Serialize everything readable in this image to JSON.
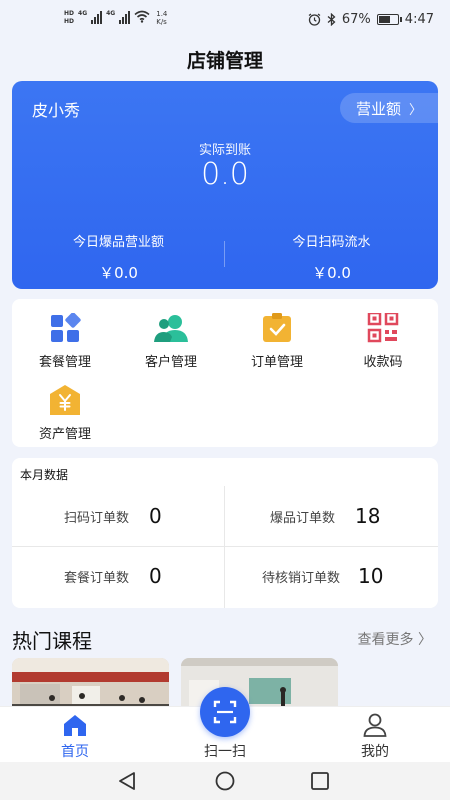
{
  "status_bar": {
    "hd_top": "HD",
    "hd_bottom": "HD",
    "net1": "4G",
    "net2": "4G",
    "speed_value": "1.4",
    "speed_unit": "K/s",
    "battery_percent": "67%",
    "battery_level": 0.67,
    "time": "4:47"
  },
  "page_title": "店铺管理",
  "hero": {
    "name": "皮小秀",
    "revenue_button": "营业额",
    "received_label": "实际到账",
    "received_amount": "0.0",
    "left_label": "今日爆品营业额",
    "left_value": "￥0.0",
    "right_label": "今日扫码流水",
    "right_value": "￥0.0",
    "color": "#2f66ef"
  },
  "menu": {
    "items": [
      {
        "label": "套餐管理",
        "icon": "package-grid-icon",
        "color": "#3f6fe8"
      },
      {
        "label": "客户管理",
        "icon": "customer-icon",
        "color": "#2bbf9a"
      },
      {
        "label": "订单管理",
        "icon": "order-clipboard-icon",
        "color": "#f2b333"
      },
      {
        "label": "收款码",
        "icon": "qr-code-icon",
        "color": "#e0485c"
      },
      {
        "label": "资产管理",
        "icon": "asset-yen-icon",
        "color": "#f2b333"
      }
    ]
  },
  "month": {
    "title": "本月数据",
    "stats": [
      {
        "label": "扫码订单数",
        "value": "0"
      },
      {
        "label": "爆品订单数",
        "value": "18"
      },
      {
        "label": "套餐订单数",
        "value": "0"
      },
      {
        "label": "待核销订单数",
        "value": "10"
      }
    ]
  },
  "courses": {
    "title": "热门课程",
    "see_more": "查看更多"
  },
  "tabbar": {
    "home": "首页",
    "scan": "扫一扫",
    "mine": "我的",
    "active_color": "#2f66ef"
  }
}
